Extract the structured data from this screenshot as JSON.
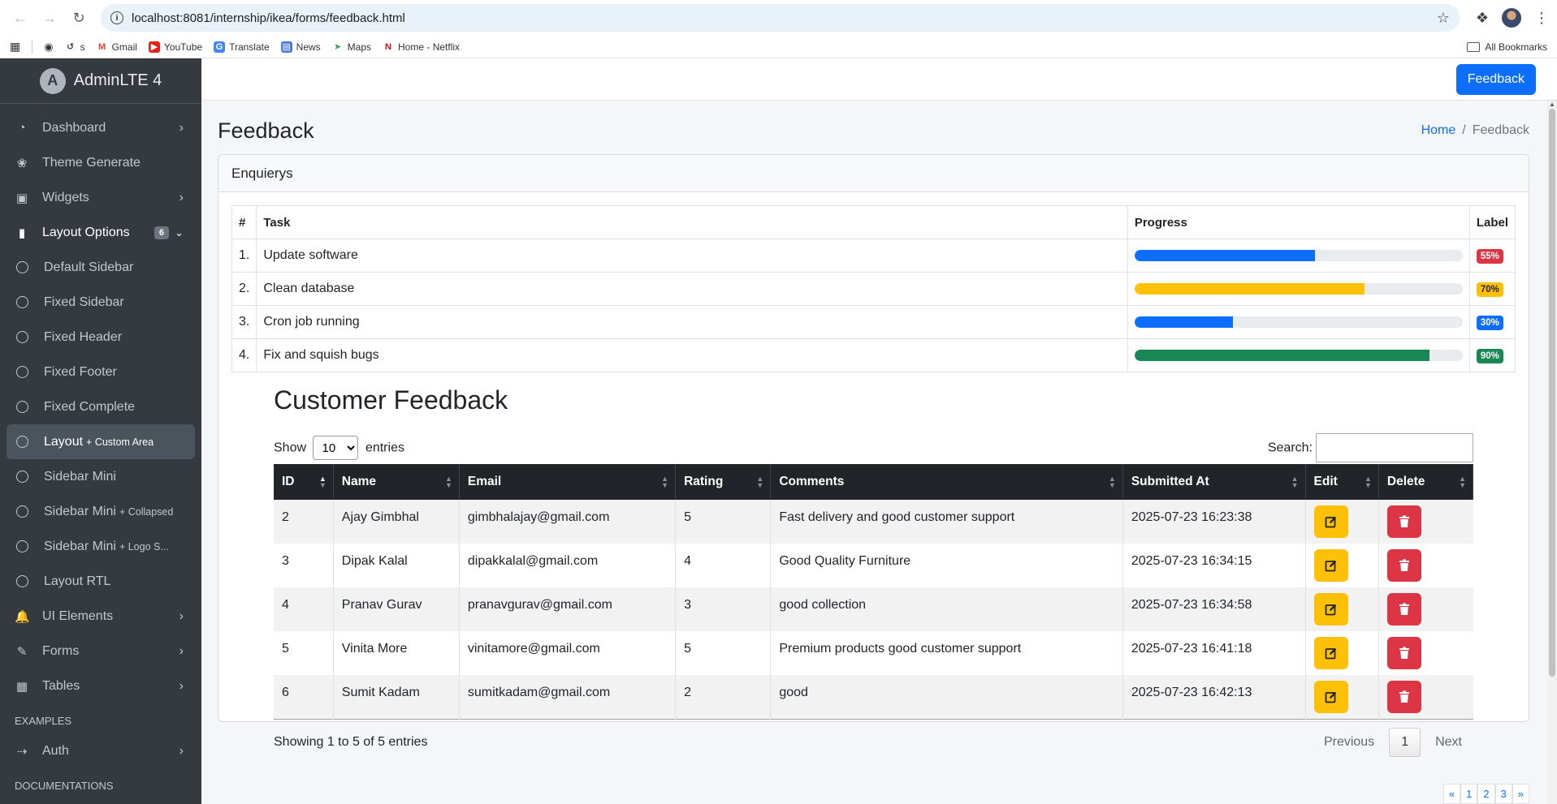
{
  "browser": {
    "url": "localhost:8081/internship/ikea/forms/feedback.html",
    "bookmarks": [
      {
        "label": "s",
        "icon": "history-icon"
      },
      {
        "label": "Gmail",
        "icon": "gmail-icon"
      },
      {
        "label": "YouTube",
        "icon": "youtube-icon"
      },
      {
        "label": "Translate",
        "icon": "translate-icon"
      },
      {
        "label": "News",
        "icon": "news-icon"
      },
      {
        "label": "Maps",
        "icon": "maps-icon"
      },
      {
        "label": "Home - Netflix",
        "icon": "netflix-icon"
      }
    ],
    "all_bookmarks": "All Bookmarks"
  },
  "sidebar": {
    "brand": "AdminLTE 4",
    "brand_logo": "A",
    "items": [
      {
        "label": "Dashboard",
        "icon": "speedometer-icon",
        "chevron": true
      },
      {
        "label": "Theme Generate",
        "icon": "palette-icon"
      },
      {
        "label": "Widgets",
        "icon": "box-icon",
        "chevron": true
      },
      {
        "label": "Layout Options",
        "icon": "clipboard-icon",
        "badge": "6",
        "open": true
      },
      {
        "label": "Default Sidebar",
        "circle": true
      },
      {
        "label": "Fixed Sidebar",
        "circle": true
      },
      {
        "label": "Fixed Header",
        "circle": true
      },
      {
        "label": "Fixed Footer",
        "circle": true
      },
      {
        "label": "Fixed Complete",
        "circle": true
      },
      {
        "label": "Layout",
        "small": "+ Custom Area",
        "circle": true,
        "active": true
      },
      {
        "label": "Sidebar Mini",
        "circle": true
      },
      {
        "label": "Sidebar Mini",
        "small": "+ Collapsed",
        "circle": true
      },
      {
        "label": "Sidebar Mini",
        "small": "+ Logo S...",
        "circle": true
      },
      {
        "label": "Layout RTL",
        "circle": true
      },
      {
        "label": "UI Elements",
        "icon": "bell-icon",
        "chevron": true
      },
      {
        "label": "Forms",
        "icon": "pencil-square-icon",
        "chevron": true
      },
      {
        "label": "Tables",
        "icon": "table-icon",
        "chevron": true
      }
    ],
    "header_examples": "EXAMPLES",
    "auth": "Auth",
    "header_docs": "DOCUMENTATIONS"
  },
  "topnav": {
    "feedback_button": "Feedback"
  },
  "page": {
    "title": "Feedback",
    "breadcrumb_home": "Home",
    "breadcrumb_sep": "/",
    "breadcrumb_current": "Feedback"
  },
  "enquiries": {
    "card_title": "Enquierys",
    "headers": [
      "#",
      "Task",
      "Progress",
      "Label"
    ],
    "rows": [
      {
        "num": "1.",
        "task": "Update software",
        "progress": 55,
        "label": "55%",
        "color": "#0d6efd",
        "label_color": "#dc3545",
        "label_dark": false
      },
      {
        "num": "2.",
        "task": "Clean database",
        "progress": 70,
        "label": "70%",
        "color": "#ffc107",
        "label_color": "#ffc107",
        "label_dark": true
      },
      {
        "num": "3.",
        "task": "Cron job running",
        "progress": 30,
        "label": "30%",
        "color": "#0d6efd",
        "label_color": "#0d6efd",
        "label_dark": false
      },
      {
        "num": "4.",
        "task": "Fix and squish bugs",
        "progress": 90,
        "label": "90%",
        "color": "#198754",
        "label_color": "#198754",
        "label_dark": false
      }
    ]
  },
  "feedback": {
    "title": "Customer Feedback",
    "show_label": "Show",
    "entries_label": "entries",
    "length_value": "10",
    "search_label": "Search:",
    "columns": [
      "ID",
      "Name",
      "Email",
      "Rating",
      "Comments",
      "Submitted At",
      "Edit",
      "Delete"
    ],
    "rows": [
      {
        "id": "2",
        "name": "Ajay Gimbhal",
        "email": "gimbhalajay@gmail.com",
        "rating": "5",
        "comments": "Fast delivery and good customer support",
        "submitted": "2025-07-23 16:23:38"
      },
      {
        "id": "3",
        "name": "Dipak Kalal",
        "email": "dipakkalal@gmail.com",
        "rating": "4",
        "comments": "Good Quality Furniture",
        "submitted": "2025-07-23 16:34:15"
      },
      {
        "id": "4",
        "name": "Pranav Gurav",
        "email": "pranavgurav@gmail.com",
        "rating": "3",
        "comments": "good collection",
        "submitted": "2025-07-23 16:34:58"
      },
      {
        "id": "5",
        "name": "Vinita More",
        "email": "vinitamore@gmail.com",
        "rating": "5",
        "comments": "Premium products good customer support",
        "submitted": "2025-07-23 16:41:18"
      },
      {
        "id": "6",
        "name": "Sumit Kadam",
        "email": "sumitkadam@gmail.com",
        "rating": "2",
        "comments": "good",
        "submitted": "2025-07-23 16:42:13"
      }
    ],
    "info": "Showing 1 to 5 of 5 entries",
    "prev": "Previous",
    "current_page": "1",
    "next": "Next"
  },
  "mini_pager": [
    "«",
    "1",
    "2",
    "3",
    "»"
  ]
}
